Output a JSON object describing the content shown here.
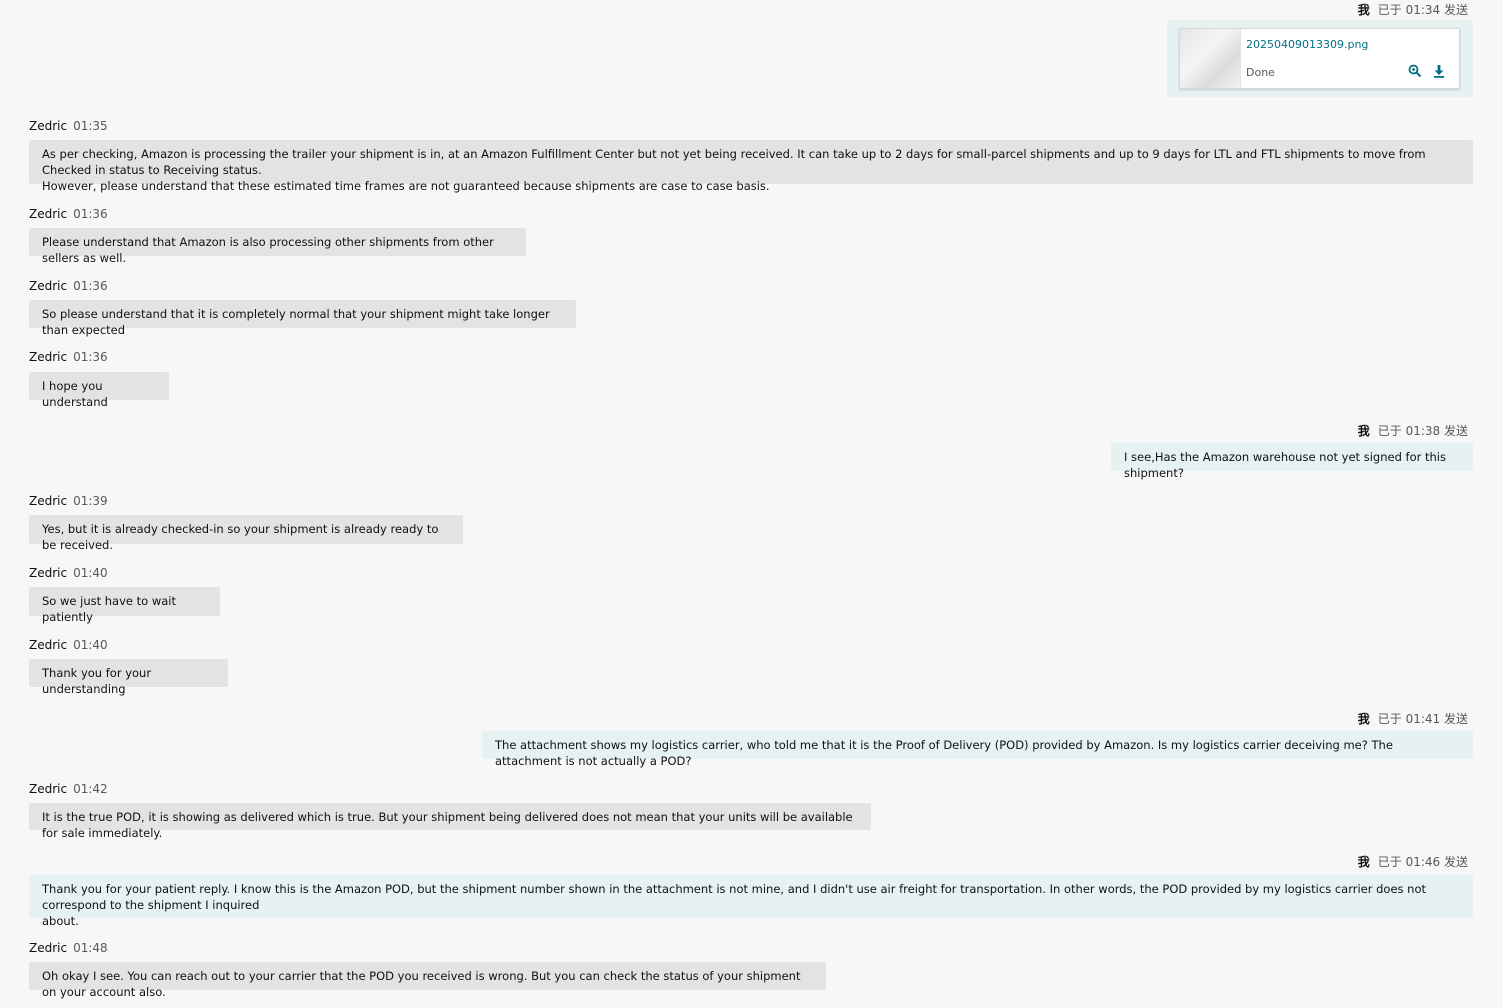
{
  "me_label": "我",
  "messages": [
    {
      "side": "me",
      "status": "已于 01:34 发送",
      "attachment": {
        "filename": "20250409013309.png",
        "status": "Done",
        "icons": [
          "magnify-icon",
          "download-icon"
        ]
      }
    },
    {
      "side": "them",
      "sender": "Zedric",
      "time": "01:35",
      "lines": [
        "As per checking, Amazon is processing the trailer your shipment is in, at an Amazon Fulfillment Center but not yet being received. It can take up to 2 days for small-parcel shipments and up to 9 days for LTL and FTL shipments to move from Checked in status to Receiving status.",
        "However, please understand that these estimated time frames are not guaranteed because shipments are case to case basis."
      ]
    },
    {
      "side": "them",
      "sender": "Zedric",
      "time": "01:36",
      "lines": [
        "Please understand that Amazon is also processing other shipments from other sellers as well."
      ]
    },
    {
      "side": "them",
      "sender": "Zedric",
      "time": "01:36",
      "lines": [
        "So please understand that it is completely normal that your shipment might take longer than expected"
      ]
    },
    {
      "side": "them",
      "sender": "Zedric",
      "time": "01:36",
      "lines": [
        "I hope you understand"
      ]
    },
    {
      "side": "me",
      "status": "已于 01:38 发送",
      "lines": [
        "I see,Has the Amazon warehouse not yet signed for this shipment?"
      ]
    },
    {
      "side": "them",
      "sender": "Zedric",
      "time": "01:39",
      "lines": [
        "Yes, but it is already checked-in so your shipment is already ready to be received."
      ]
    },
    {
      "side": "them",
      "sender": "Zedric",
      "time": "01:40",
      "lines": [
        "So we just have to wait patiently"
      ]
    },
    {
      "side": "them",
      "sender": "Zedric",
      "time": "01:40",
      "lines": [
        "Thank you for your understanding"
      ]
    },
    {
      "side": "me",
      "status": "已于 01:41 发送",
      "lines": [
        "The attachment shows my logistics carrier, who told me that it is the Proof of Delivery (POD) provided by Amazon. Is my logistics carrier deceiving me? The attachment is not actually a POD?"
      ]
    },
    {
      "side": "them",
      "sender": "Zedric",
      "time": "01:42",
      "lines": [
        "It is the true POD, it is showing as delivered which is true. But your shipment being delivered does not mean that your units will be available for sale immediately."
      ]
    },
    {
      "side": "me",
      "status": "已于 01:46 发送",
      "lines": [
        "Thank you for your patient reply. I know this is the Amazon POD, but the shipment number shown in the attachment is not mine, and I didn't use air freight for transportation. In other words, the POD provided by my logistics carrier does not correspond to the shipment I inquired",
        "about."
      ]
    },
    {
      "side": "them",
      "sender": "Zedric",
      "time": "01:48",
      "lines": [
        "Oh okay I see. You can reach out to your carrier that the POD you received is wrong. But you can check the status of your shipment on your account also."
      ]
    }
  ]
}
